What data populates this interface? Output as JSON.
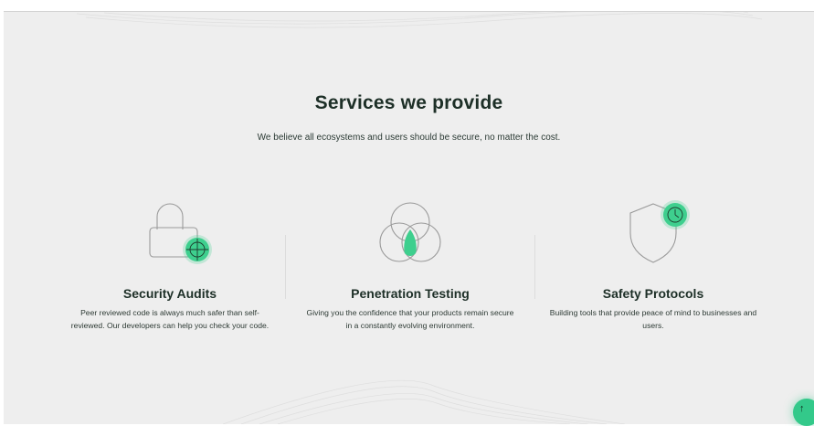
{
  "section": {
    "title": "Services we provide",
    "subtitle": "We believe all ecosystems and users should be secure, no matter the cost."
  },
  "services": [
    {
      "icon": "padlock-crosshair-icon",
      "title": "Security Audits",
      "description": "Peer reviewed code is always much safer than self-reviewed. Our developers can help you check your code."
    },
    {
      "icon": "venn-diagram-icon",
      "title": "Penetration Testing",
      "description": "Giving you the confidence that your products remain secure in a constantly evolving environment."
    },
    {
      "icon": "shield-clock-icon",
      "title": "Safety Protocols",
      "description": "Building tools that provide peace of mind to businesses and users."
    }
  ],
  "scroll_to_top": {
    "icon": "arrow-up-icon",
    "glyph": "↑"
  },
  "colors": {
    "background": "#eeeeee",
    "accent": "#3ecf8e",
    "text": "#1d2f27"
  }
}
